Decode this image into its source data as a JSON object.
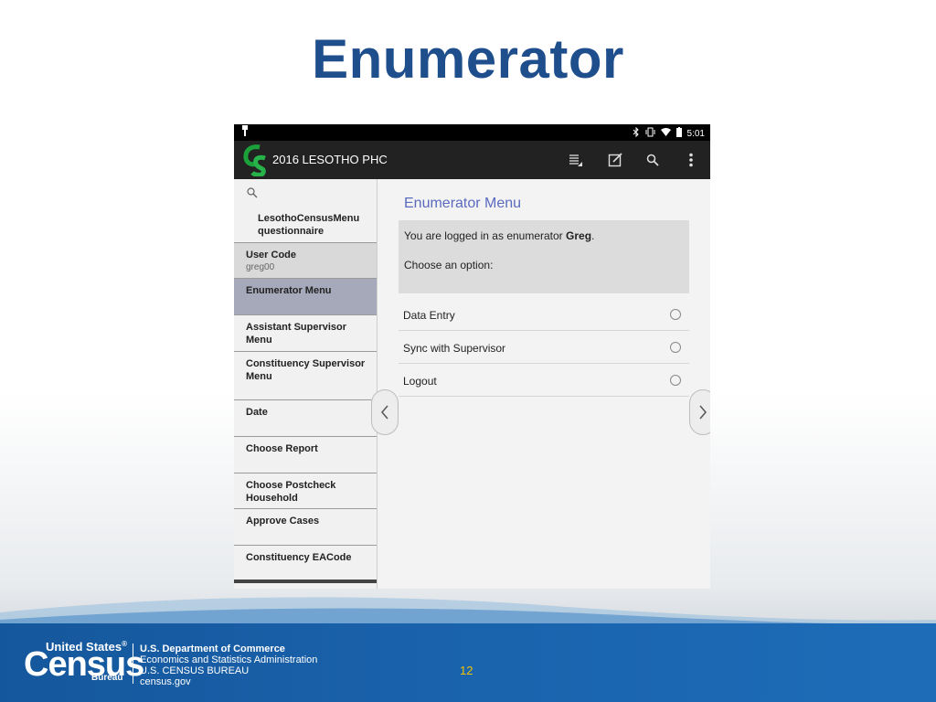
{
  "slide": {
    "title": "Enumerator",
    "page_number": "12"
  },
  "statusbar": {
    "time": "5:01",
    "icons": [
      "usb-icon",
      "bluetooth-icon",
      "vibrate-icon",
      "wifi-icon",
      "battery-icon"
    ]
  },
  "actionbar": {
    "app_logo": "CS",
    "app_title": "2016 LESOTHO PHC",
    "icons": [
      "list-icon",
      "edit-icon",
      "search-icon",
      "overflow-menu-icon"
    ]
  },
  "drawer": {
    "heading_line1": "LesothoCensusMenu",
    "heading_line2": "questionnaire",
    "user_code_label": "User Code",
    "user_code_value": "greg00",
    "items": [
      {
        "label": "Enumerator Menu"
      },
      {
        "label": "Assistant Supervisor Menu"
      },
      {
        "label": "Constituency Supervisor",
        "label2": "Menu"
      },
      {
        "label": "Date"
      },
      {
        "label": "Choose Report"
      },
      {
        "label": "Choose Postcheck Household"
      },
      {
        "label": "Approve Cases"
      },
      {
        "label": "Constituency EACode"
      }
    ]
  },
  "main": {
    "title": "Enumerator Menu",
    "logged_in_prefix": "You are logged in as enumerator ",
    "enumerator_name": "Greg",
    "logged_in_suffix": ".",
    "prompt": "Choose an option:",
    "options": [
      {
        "label": "Data Entry"
      },
      {
        "label": "Sync with Supervisor"
      },
      {
        "label": "Logout"
      }
    ]
  },
  "footer": {
    "logo_line1": "United States",
    "logo_trademark": "®",
    "logo_census": "Census",
    "logo_bureau": "Bureau",
    "dept": "U.S. Department of Commerce",
    "line2": "Economics and Statistics Administration",
    "line3": "U.S. CENSUS BUREAU",
    "line4": "census.gov"
  },
  "colors": {
    "title": "#1f4e8c",
    "selected_item": "#a6a9ba",
    "menu_title": "#5a6abf",
    "footer_band": "#1a63ad",
    "page_number": "#f2c200"
  }
}
